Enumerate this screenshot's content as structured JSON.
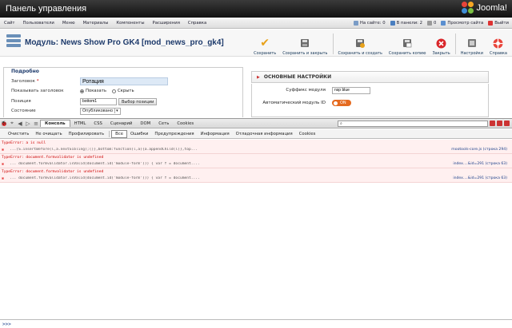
{
  "header": {
    "title": "Панель управления",
    "logo_text": "Joomla!"
  },
  "menu": [
    "Сайт",
    "Пользователи",
    "Меню",
    "Материалы",
    "Компоненты",
    "Расширения",
    "Справка"
  ],
  "status": {
    "on_site": "На сайте: 0",
    "in_panel": "В панели: 2",
    "messages": "0",
    "view_site": "Просмотр сайта",
    "logout": "Выйти"
  },
  "page": {
    "title": "Модуль: News Show Pro GK4 [mod_news_pro_gk4]"
  },
  "toolbar": [
    {
      "label": "Сохранить",
      "icon": "check-icon"
    },
    {
      "label": "Сохранить и закрыть",
      "icon": "save-close-icon"
    },
    {
      "label": "Сохранить и создать",
      "icon": "save-new-icon"
    },
    {
      "label": "Сохранить копию",
      "icon": "save-copy-icon"
    },
    {
      "label": "Закрыть",
      "icon": "close-icon"
    },
    {
      "label": "Настройки",
      "icon": "settings-icon"
    },
    {
      "label": "Справка",
      "icon": "help-icon"
    }
  ],
  "details": {
    "legend": "Подробно",
    "title_label": "Заголовок",
    "title_value": "Ротация",
    "show_title_label": "Показывать заголовок",
    "show_option": "Показать",
    "hide_option": "Скрыть",
    "position_label": "Позиция",
    "position_value": "bottom1",
    "position_button": "Выбор позиции",
    "state_label": "Состояние",
    "state_value": "Опубликовано"
  },
  "basic": {
    "header": "ОСНОВНЫЕ НАСТРОЙКИ",
    "suffix_label": "Суффикс модуля",
    "suffix_value": "nsp blue",
    "auto_id_label": "Автоматический модуль ID",
    "auto_id_value": "ON"
  },
  "firebug": {
    "tabs": [
      "Консоль",
      "HTML",
      "CSS",
      "Сценарий",
      "DOM",
      "Сеть",
      "Cookies"
    ],
    "active_tab": "Консоль",
    "sub": [
      "Очистить",
      "Не очищать",
      "Профилировать",
      "Все",
      "Ошибки",
      "Предупреждения",
      "Информация",
      "Отладочная информация",
      "Cookies"
    ],
    "active_sub": "Все",
    "logs": [
      {
        "type": "head",
        "text": "TypeError: a is null"
      },
      {
        "type": "err",
        "code": "...(S.insertBefore(l,a.nextSibling);()},bottom:function(l,a){a.appendChild(l)},top...",
        "src": "mootools-core.js (строка 294)"
      },
      {
        "type": "head",
        "text": "TypeError: document.formvalidator is undefined"
      },
      {
        "type": "err",
        "code": "... document.formvalidator.isValid(document.id('module-form'))) {        var f = document....",
        "src": "index....&id=291 (строка 63)"
      },
      {
        "type": "head",
        "text": "TypeError: document.formvalidator is undefined"
      },
      {
        "type": "err",
        "code": "... document.formvalidator.isValid(document.id('module-form'))) {        var f = document....",
        "src": "index....&id=291 (строка 63)"
      }
    ],
    "prompt": ">>>"
  }
}
